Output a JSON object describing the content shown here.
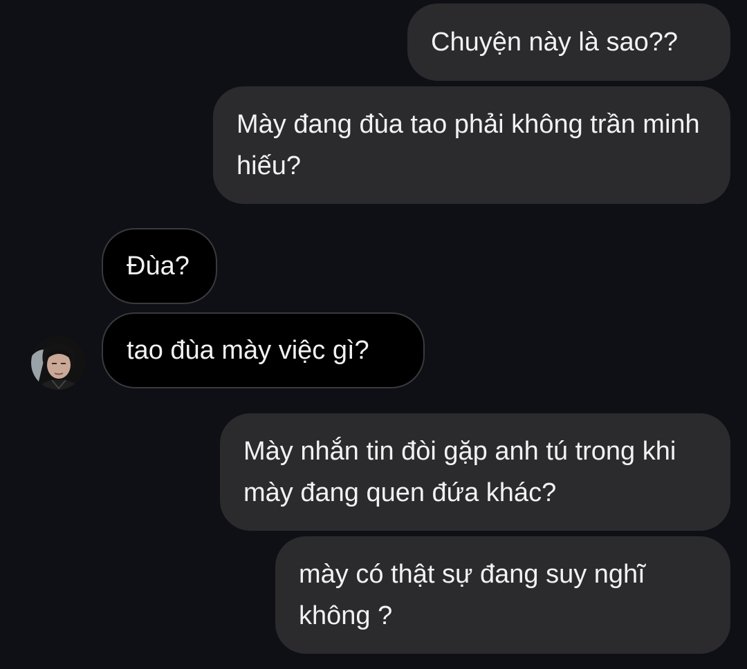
{
  "colors": {
    "background": "#0f1015",
    "outgoing_bubble": "#2b2b2e",
    "incoming_bubble": "#000000",
    "incoming_border": "#3a3a3e",
    "text": "#f2f2f2"
  },
  "messages": [
    {
      "direction": "outgoing",
      "text": "Chuyện này là sao??"
    },
    {
      "direction": "outgoing",
      "text": "Mày đang đùa tao phải không trần minh hiếu?"
    },
    {
      "direction": "incoming",
      "text": "Đùa?"
    },
    {
      "direction": "incoming",
      "text": "tao đùa mày việc gì?"
    },
    {
      "direction": "outgoing",
      "text": "Mày nhắn tin đòi gặp anh tú trong khi mày đang quen đứa khác?"
    },
    {
      "direction": "outgoing",
      "text": "mày có thật sự đang suy nghĩ không ?"
    }
  ],
  "contact": {
    "avatar_icon": "person-avatar-icon"
  }
}
